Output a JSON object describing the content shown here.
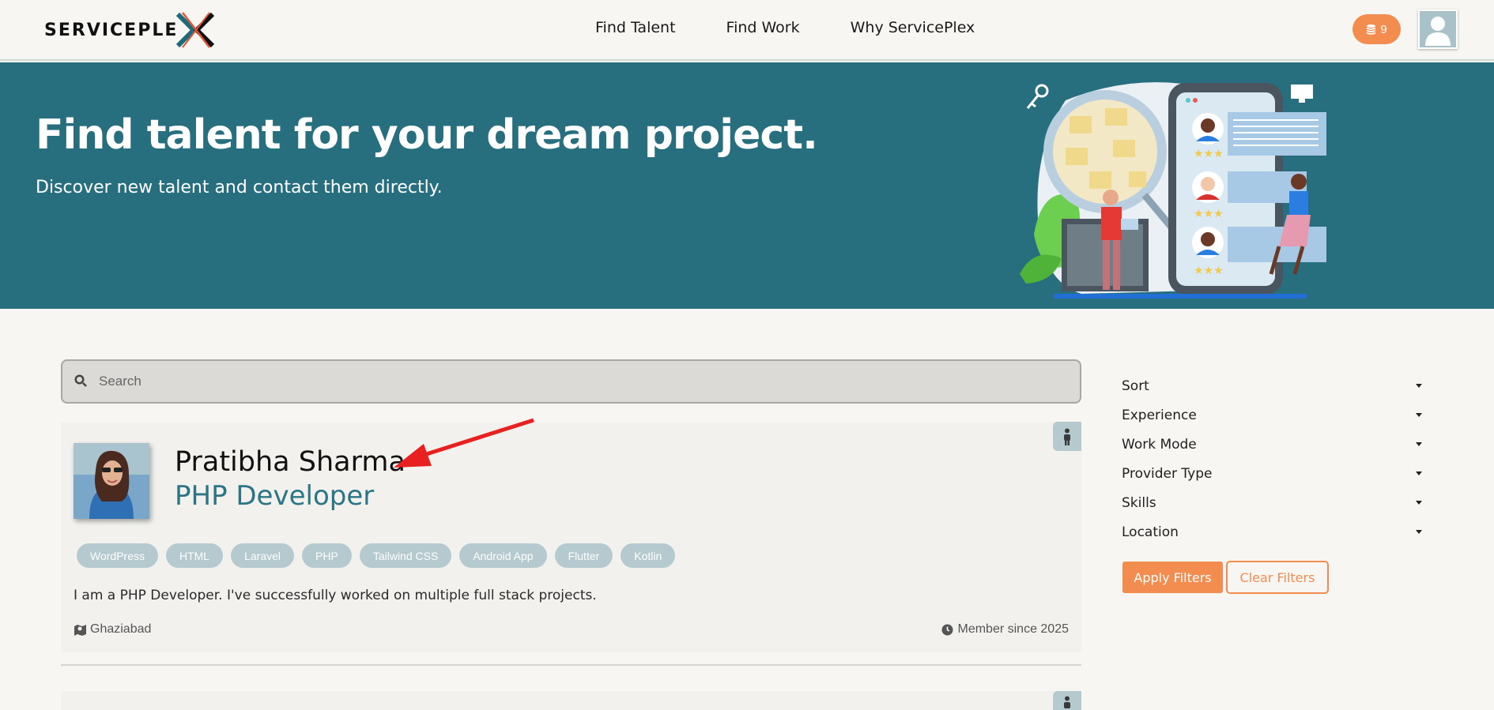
{
  "header": {
    "logo_text": "SERVICEPLE",
    "nav": [
      "Find Talent",
      "Find Work",
      "Why ServicePlex"
    ],
    "coins": "9"
  },
  "hero": {
    "title": "Find talent for your dream project.",
    "subtitle": "Discover new talent and contact them directly."
  },
  "search": {
    "placeholder": "Search"
  },
  "profile": {
    "name": "Pratibha Sharma",
    "role": "PHP Developer",
    "skills": [
      "WordPress",
      "HTML",
      "Laravel",
      "PHP",
      "Tailwind CSS",
      "Android App",
      "Flutter",
      "Kotlin"
    ],
    "bio": "I am a PHP Developer. I've successfully worked on multiple full stack projects.",
    "location": "Ghaziabad",
    "member_since": "Member since 2025"
  },
  "filters": {
    "items": [
      "Sort",
      "Experience",
      "Work Mode",
      "Provider Type",
      "Skills",
      "Location"
    ],
    "apply_label": "Apply Filters",
    "clear_label": "Clear Filters"
  },
  "colors": {
    "teal": "#276f7e",
    "accent": "#f38c4f",
    "chip": "#b5cacf"
  }
}
